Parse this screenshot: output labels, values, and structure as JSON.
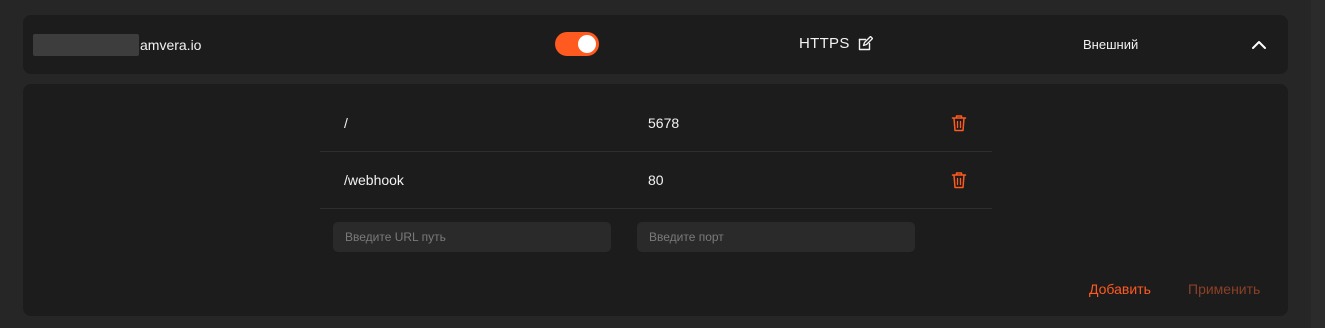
{
  "header": {
    "domain_suffix": "amvera.io",
    "toggle_enabled": true,
    "protocol": "HTTPS",
    "scope": "Внешний"
  },
  "routes": [
    {
      "path": "/",
      "port": "5678"
    },
    {
      "path": "/webhook",
      "port": "80"
    }
  ],
  "new_route": {
    "path_placeholder": "Введите URL путь",
    "port_placeholder": "Введите порт"
  },
  "actions": {
    "add_label": "Добавить",
    "apply_label": "Применить"
  },
  "colors": {
    "accent": "#ff5a1f",
    "accent_disabled": "#8a4026",
    "card_bg": "#1c1c1c",
    "page_bg": "#262626"
  },
  "icons": {
    "edit": "edit-icon",
    "collapse": "chevron-up-icon",
    "delete": "trash-icon"
  }
}
